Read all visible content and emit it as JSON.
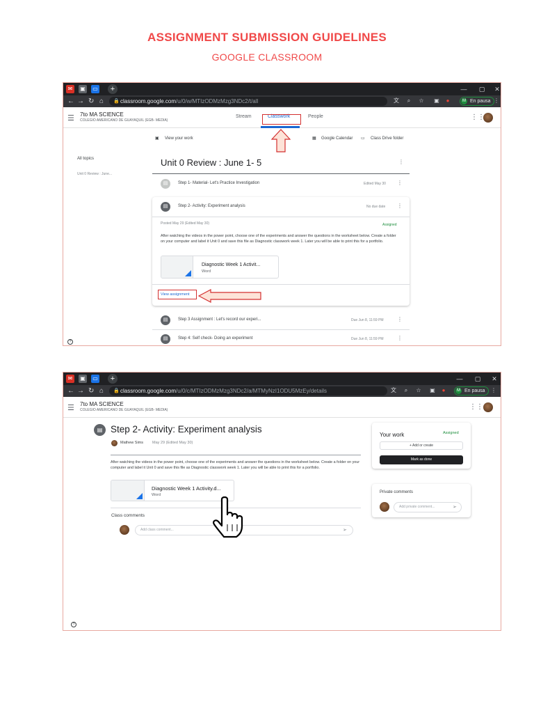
{
  "doc": {
    "title": "ASSIGNMENT SUBMISSION GUIDELINES",
    "subtitle": "GOOGLE CLASSROOM"
  },
  "colors": {
    "accent_red": "#f04848",
    "assigned_green": "#1e8e3e",
    "chrome_dark": "#202124"
  },
  "screenshot1": {
    "browser": {
      "url_host": "classroom.google.com",
      "url_path": "/u/0/w/MTIzODMzMzg3NDc2/t/all",
      "profile": "En pausa",
      "profile_initial": "M"
    },
    "class_name": "7to MA SCIENCE",
    "school": "COLEGIO AMERICANO DE GUAYAQUIL (EGB- MEDIA)",
    "tabs": [
      "Stream",
      "Classwork",
      "People"
    ],
    "view_your_work": "View your work",
    "google_calendar": "Google Calendar",
    "drive_folder": "Class Drive folder",
    "sidebar": {
      "all_topics": "All topics",
      "topic_item": "Unit 0 Review : June..."
    },
    "topic_title": "Unit 0 Review : June 1- 5",
    "items": [
      {
        "title": "Step 1- Material- Let's Practice Investigation",
        "meta": "Edited May 30"
      },
      {
        "title": "Step 2- Activity: Experiment analysis",
        "meta": "No due date"
      },
      {
        "title": "Step 3 Assignment : Let's record our experi...",
        "meta": "Due Jun 8, 11:59 PM"
      },
      {
        "title": "Step 4: Self check- Doing an experiment",
        "meta": "Due Jun 8, 11:59 PM"
      }
    ],
    "expanded": {
      "posted": "Posted May 29 (Edited May 30)",
      "status": "Assigned",
      "description": "After watching the videos in the power point, choose one of the experiments and answer the questions in the worksheet below. Create a folder on your computer and label it Unit 0 and save this file as Diagnostic classwork week 1. Later you will be able to print this for a portfolio.",
      "attachment_title": "Diagnostic Week 1 Activit...",
      "attachment_type": "Word",
      "view_assignment": "View assignment"
    }
  },
  "screenshot2": {
    "browser": {
      "url_host": "classroom.google.com",
      "url_path": "/u/0/c/MTIzODMzMzg3NDc2/a/MTMyNzI1ODU5MzEy/details",
      "profile": "En pausa",
      "profile_initial": "M"
    },
    "class_name": "7to MA SCIENCE",
    "school": "COLEGIO AMERICANO DE GUAYAQUIL (EGB- MEDIA)",
    "assignment_title": "Step 2- Activity: Experiment analysis",
    "author": "Mathew Sims",
    "date": "May 29 (Edited May 30)",
    "description": "After watching the videos in the power point, choose one of the experiments and answer the questions in the worksheet below. Create a folder on your computer and label it Unit 0 and save this file as Diagnostic classwork week 1. Later you will be able to print this for a portfolio.",
    "attachment_title": "Diagnostic Week 1 Activity.d...",
    "attachment_type": "Word",
    "class_comments": "Class comments",
    "add_class_comment": "Add class comment...",
    "your_work": "Your work",
    "status": "Assigned",
    "add_or_create": "Add or create",
    "mark_as_done": "Mark as done",
    "private_comments": "Private comments",
    "add_private_comment": "Add private comment..."
  }
}
